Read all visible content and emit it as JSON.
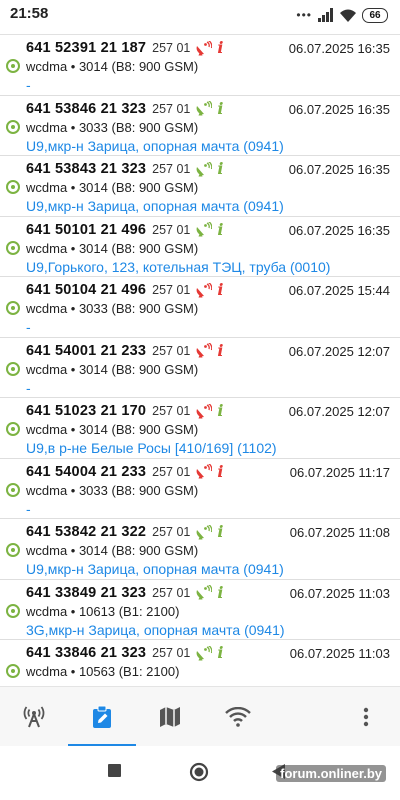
{
  "status_bar": {
    "time": "21:58",
    "dots": "•••",
    "battery": "66"
  },
  "colors": {
    "accent": "#1e88e5",
    "ok_green": "#7cb342",
    "info_red": "#e53935",
    "info_green": "#7cb342"
  },
  "rows": [
    {
      "id": "641 52391 21 187",
      "mcc": "257 01",
      "antenna_color": "#e53935",
      "info_color": "#e53935",
      "date": "06.07.2025 16:35",
      "tech": "wcdma • 3014 (B8: 900 GSM)",
      "address": "-"
    },
    {
      "id": "641 53846 21 323",
      "mcc": "257 01",
      "antenna_color": "#7cb342",
      "info_color": "#7cb342",
      "date": "06.07.2025 16:35",
      "tech": "wcdma • 3033 (B8: 900 GSM)",
      "address": "U9,мкр-н Зарица, опорная мачта (0941)"
    },
    {
      "id": "641 53843 21 323",
      "mcc": "257 01",
      "antenna_color": "#7cb342",
      "info_color": "#7cb342",
      "date": "06.07.2025 16:35",
      "tech": "wcdma • 3014 (B8: 900 GSM)",
      "address": "U9,мкр-н Зарица, опорная мачта (0941)"
    },
    {
      "id": "641 50101 21 496",
      "mcc": "257 01",
      "antenna_color": "#7cb342",
      "info_color": "#7cb342",
      "date": "06.07.2025 16:35",
      "tech": "wcdma • 3014 (B8: 900 GSM)",
      "address": "U9,Горького, 123, котельная ТЭЦ, труба (0010)"
    },
    {
      "id": "641 50104 21 496",
      "mcc": "257 01",
      "antenna_color": "#e53935",
      "info_color": "#e53935",
      "date": "06.07.2025 15:44",
      "tech": "wcdma • 3033 (B8: 900 GSM)",
      "address": "-"
    },
    {
      "id": "641 54001 21 233",
      "mcc": "257 01",
      "antenna_color": "#e53935",
      "info_color": "#e53935",
      "date": "06.07.2025 12:07",
      "tech": "wcdma • 3014 (B8: 900 GSM)",
      "address": "-"
    },
    {
      "id": "641 51023 21 170",
      "mcc": "257 01",
      "antenna_color": "#e53935",
      "info_color": "#7cb342",
      "date": "06.07.2025 12:07",
      "tech": "wcdma • 3014 (B8: 900 GSM)",
      "address": "U9,в р-не Белые Росы [410/169] (1102)"
    },
    {
      "id": "641 54004 21 233",
      "mcc": "257 01",
      "antenna_color": "#e53935",
      "info_color": "#e53935",
      "date": "06.07.2025 11:17",
      "tech": "wcdma • 3033 (B8: 900 GSM)",
      "address": "-"
    },
    {
      "id": "641 53842 21 322",
      "mcc": "257 01",
      "antenna_color": "#7cb342",
      "info_color": "#7cb342",
      "date": "06.07.2025 11:08",
      "tech": "wcdma • 3014 (B8: 900 GSM)",
      "address": "U9,мкр-н Зарица, опорная мачта (0941)"
    },
    {
      "id": "641 33849 21 323",
      "mcc": "257 01",
      "antenna_color": "#7cb342",
      "info_color": "#7cb342",
      "date": "06.07.2025 11:03",
      "tech": "wcdma • 10613 (B1: 2100)",
      "address": "3G,мкр-н Зарица, опорная мачта (0941)"
    },
    {
      "id": "641 33846 21 323",
      "mcc": "257 01",
      "antenna_color": "#7cb342",
      "info_color": "#7cb342",
      "date": "06.07.2025 11:03",
      "tech": "wcdma • 10563 (B1: 2100)",
      "address": ""
    }
  ],
  "bottom_nav": {
    "items": [
      {
        "icon": "cell-tower-icon",
        "active": false
      },
      {
        "icon": "log-clipboard-icon",
        "active": true
      },
      {
        "icon": "map-icon",
        "active": false
      },
      {
        "icon": "wifi-icon",
        "active": false
      }
    ],
    "menu_icon": "more-vert-icon"
  },
  "system_nav": {
    "watermark": "forum.onliner.by"
  }
}
